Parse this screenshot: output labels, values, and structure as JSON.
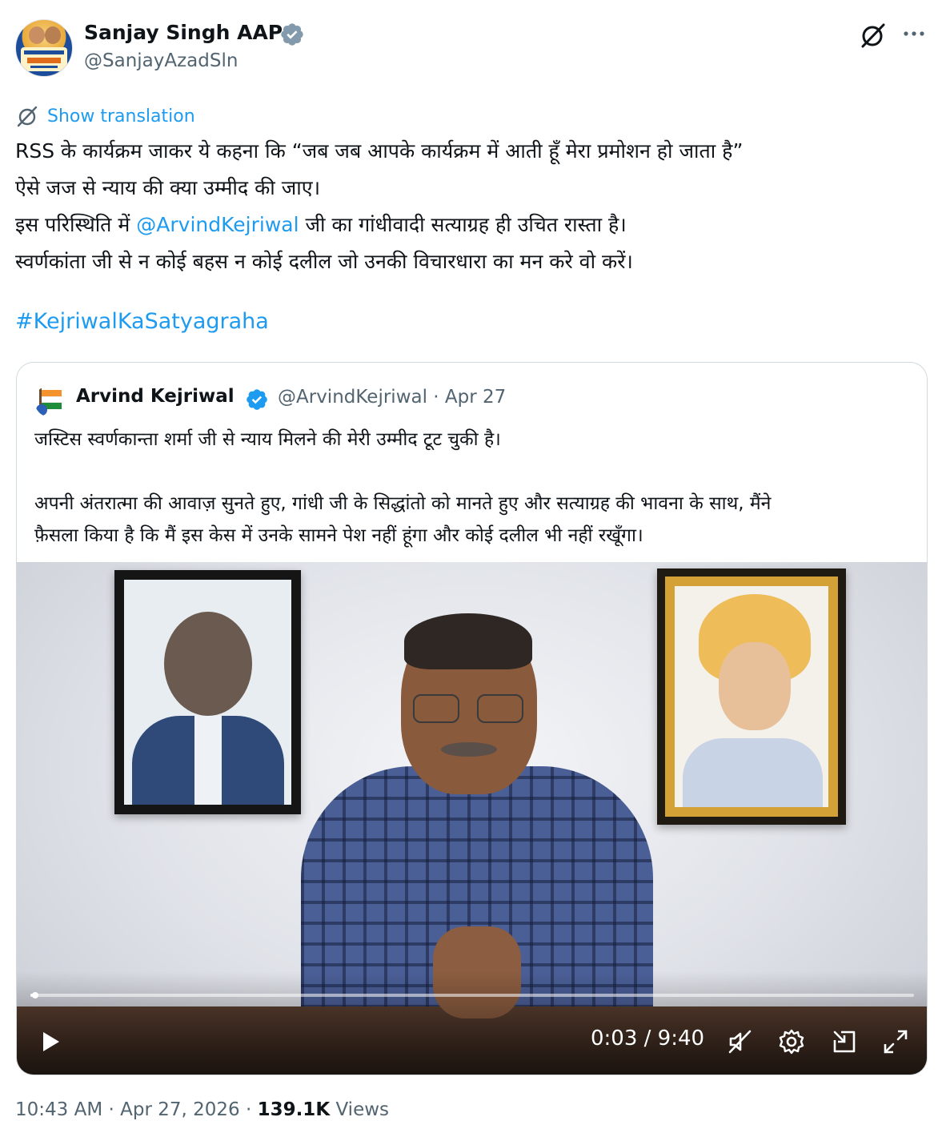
{
  "author": {
    "name": "Sanjay Singh AAP",
    "handle": "@SanjayAzadSln",
    "avatar_icon": "profile-avatar",
    "verified_color": "#829aab"
  },
  "actions": {
    "grok_icon": "grok-icon",
    "more_icon": "more-icon"
  },
  "translation": {
    "label": "Show translation",
    "icon": "grok-icon"
  },
  "tweet": {
    "lines": [
      "RSS के कार्यक्रम जाकर ये कहना कि “जब जब आपके कार्यक्रम में आती हूँ मेरा प्रमोशन हो जाता है”",
      "ऐसे जज से न्याय की क्या उम्मीद की जाए।"
    ],
    "line3_before": "इस परिस्थिति में ",
    "line3_mention": "@ArvindKejriwal",
    "line3_after": " जी का गांधीवादी सत्याग्रह ही उचित रास्ता है।",
    "line4": "स्वर्णकांता जी से न कोई बहस न कोई दलील जो उनकी विचारधारा का मन करे वो करें।",
    "hashtag": "#KejriwalKaSatyagraha",
    "link_color": "#1d9bf0"
  },
  "quote": {
    "name": "Arvind Kejriwal",
    "meta": "@ArvindKejriwal · Apr 27",
    "verified_color": "#1d9bf0",
    "text_line1": "जस्टिस स्वर्णकान्ता शर्मा जी से न्याय मिलने की मेरी उम्मीद टूट चुकी है।",
    "text_line3": "अपनी अंतरात्मा की आवाज़ सुनते हुए, गांधी जी के सिद्धांतो को मानते हुए और सत्याग्रह की भावना के साथ, मैंने",
    "text_line4": "फ़ैसला किया है कि मैं इस केस में उनके सामने पेश नहीं हूंगा और कोई दलील भी नहीं रखूँगा।"
  },
  "video": {
    "time": "0:03 / 9:40",
    "progress_fraction": 0.005,
    "controls": [
      "play-icon",
      "mute-icon",
      "settings-icon",
      "pip-icon",
      "fullscreen-icon"
    ]
  },
  "footer": {
    "timestamp": "10:43 AM · Apr 27, 2026 · ",
    "views_count": "139.1K",
    "views_label": " Views"
  }
}
